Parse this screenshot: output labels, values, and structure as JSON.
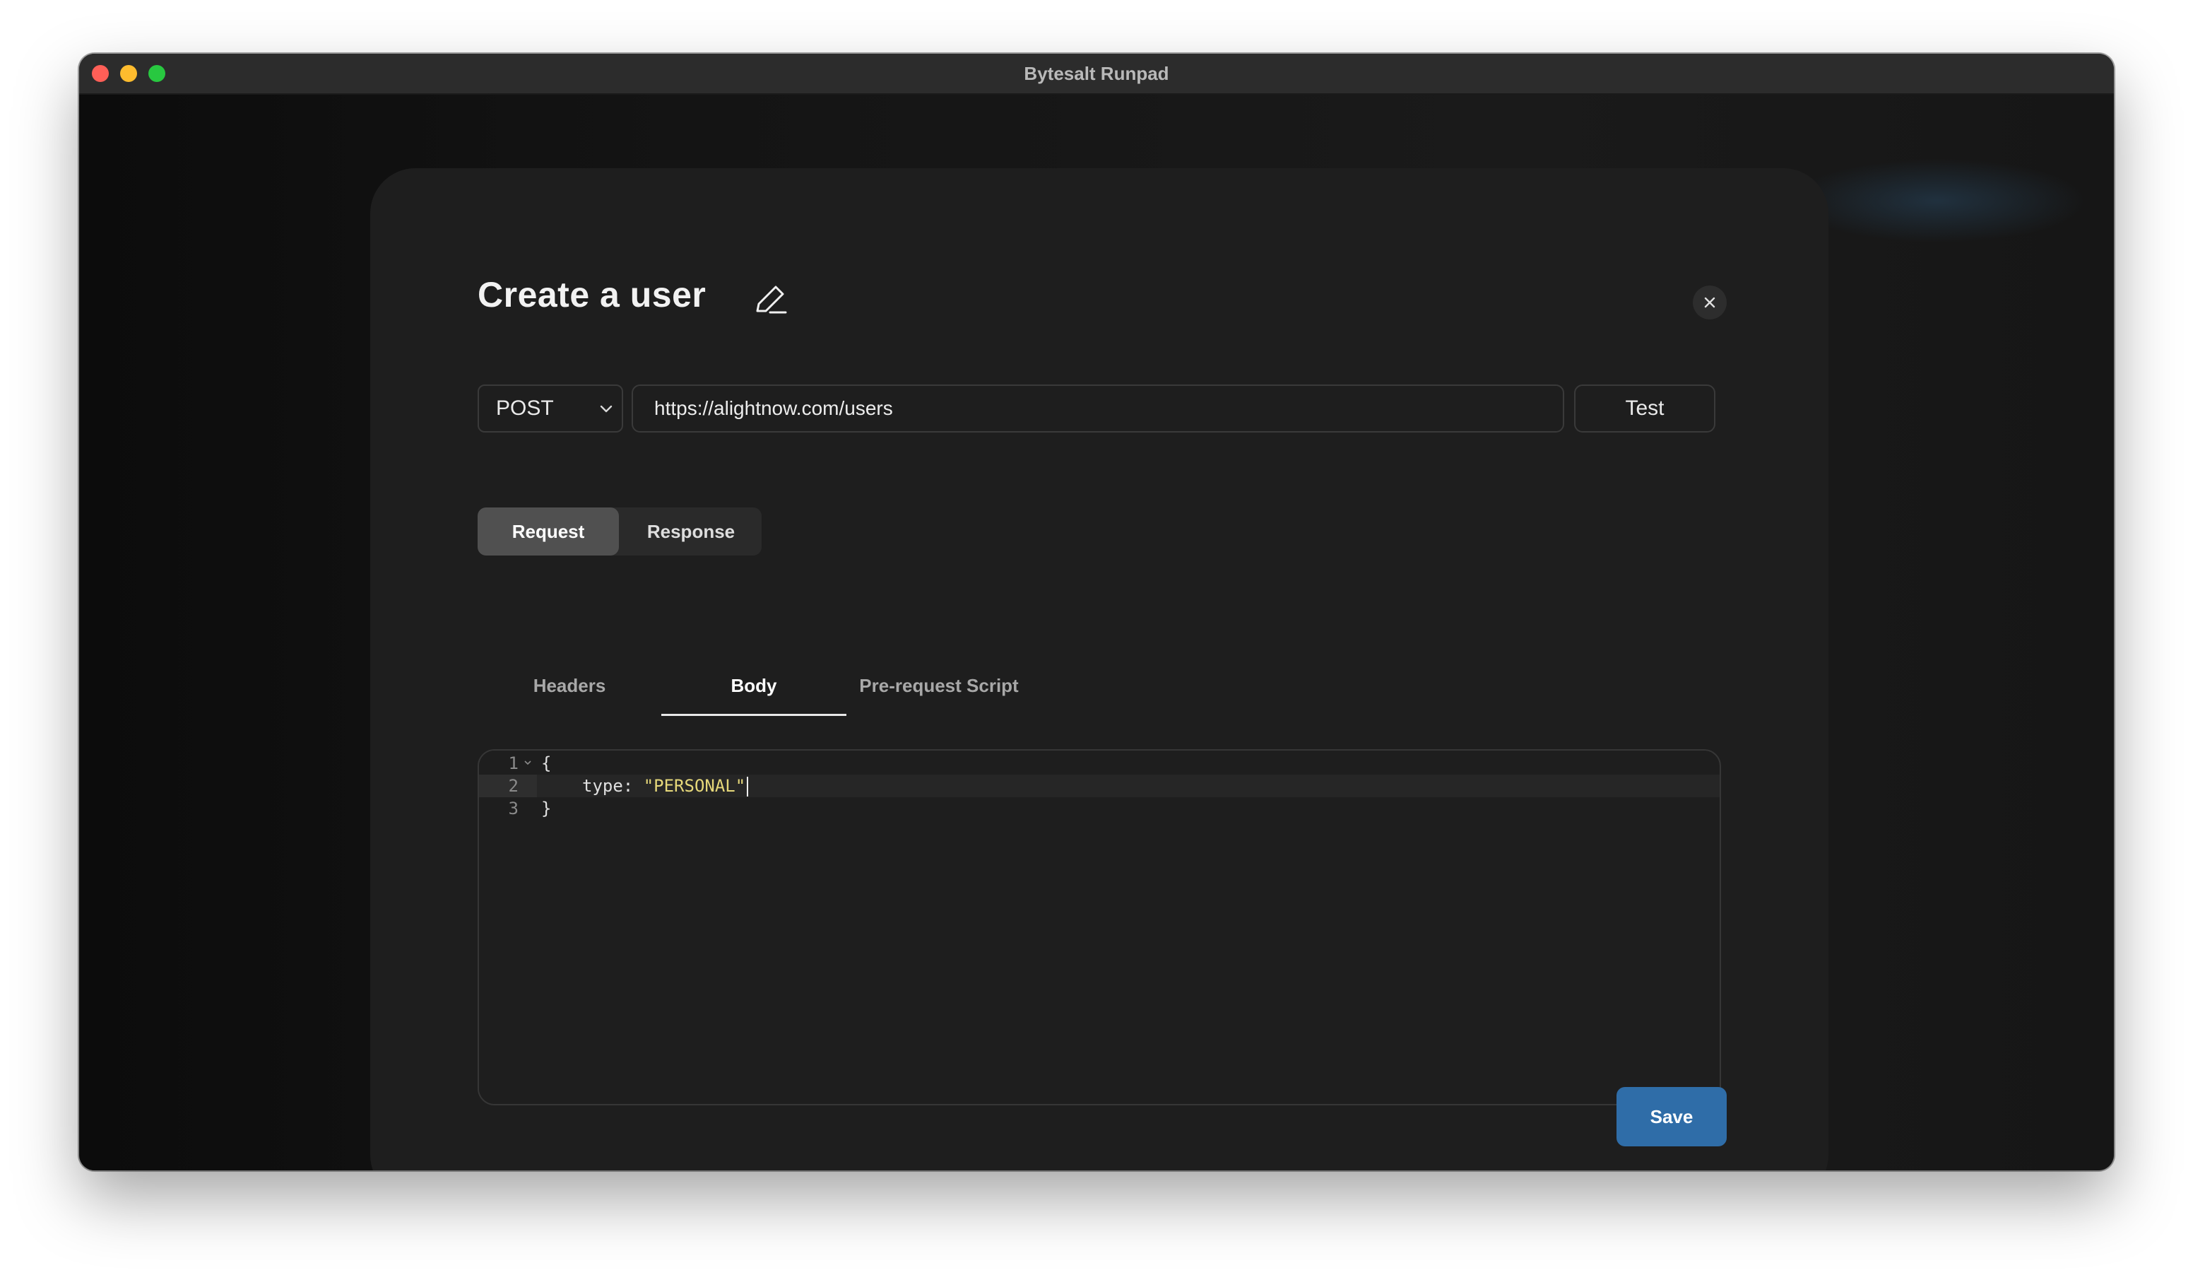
{
  "window": {
    "title": "Bytesalt Runpad",
    "controls": [
      "close",
      "minimize",
      "maximize"
    ]
  },
  "modal": {
    "title": "Create a user",
    "edit_icon": "pencil-icon",
    "close_icon": "close-icon"
  },
  "request": {
    "method": "POST",
    "url": "https://alightnow.com/users",
    "test_label": "Test"
  },
  "segmented": {
    "items": [
      {
        "label": "Request",
        "active": true
      },
      {
        "label": "Response",
        "active": false
      }
    ]
  },
  "tabs": {
    "items": [
      {
        "label": "Headers",
        "active": false
      },
      {
        "label": "Body",
        "active": true
      },
      {
        "label": "Pre-request Script",
        "active": false
      }
    ]
  },
  "editor": {
    "lines": [
      {
        "number": "1",
        "text": "{"
      },
      {
        "number": "2",
        "key": "type: ",
        "string": "\"PERSONAL\""
      },
      {
        "number": "3",
        "text": "}"
      }
    ]
  },
  "footer": {
    "save_label": "Save"
  },
  "colors": {
    "accent": "#2f6da8",
    "string": "#e6d87a",
    "modal_bg": "#1e1e1e"
  }
}
